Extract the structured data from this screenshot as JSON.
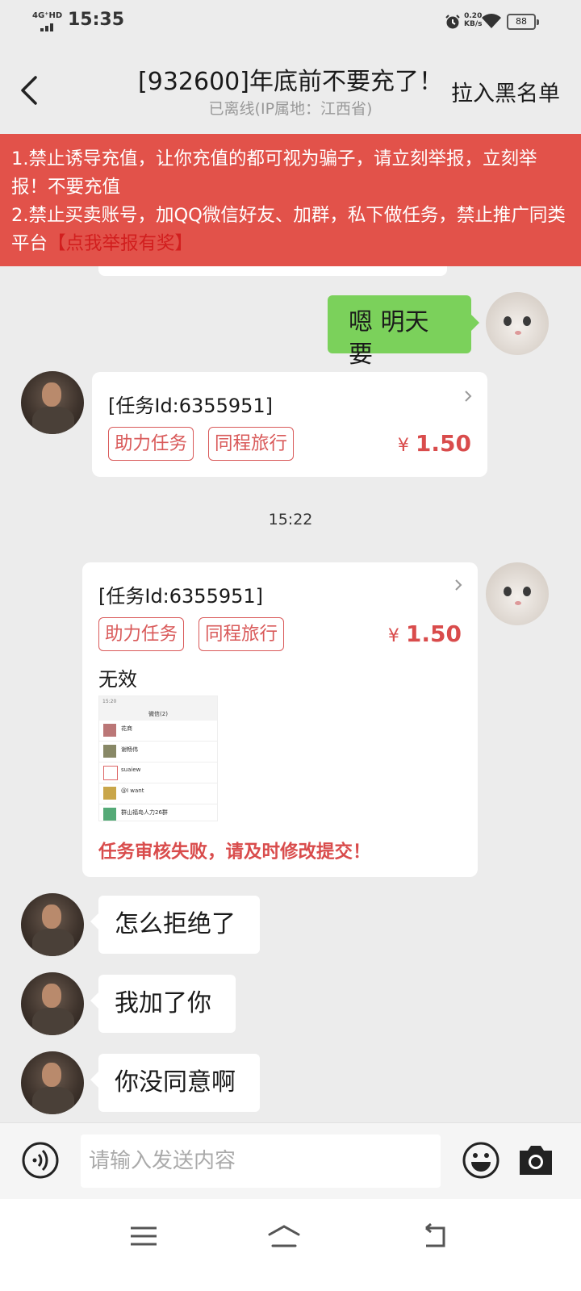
{
  "status_bar": {
    "network": "4G⁺HD",
    "time": "15:35",
    "speed_value": "0.20",
    "speed_unit": "KB/s",
    "battery": "88"
  },
  "header": {
    "title": "[932600]年底前不要充了！",
    "subtitle": "已离线(IP属地：江西省)",
    "blacklist": "拉入黑名单"
  },
  "banner": {
    "line1": "1.禁止诱导充值，让你充值的都可视为骗子，请立刻举报，立刻举报！不要充值",
    "line2": "2.禁止买卖账号，加QQ微信好友、加群，私下做任务，禁止推广同类平台",
    "report_link": "【点我举报有奖】"
  },
  "messages": {
    "m1": "嗯 明天要",
    "task1": {
      "id_text": "[任务Id:6355951]",
      "tags": [
        "助力任务",
        "同程旅行"
      ],
      "currency": "¥",
      "price": "1.50"
    },
    "timestamp": "15:22",
    "task2": {
      "id_text": "[任务Id:6355951]",
      "tags": [
        "助力任务",
        "同程旅行"
      ],
      "currency": "¥",
      "price": "1.50",
      "result": "无效",
      "fail_note": "任务审核失败，请及时修改提交！",
      "thumb": {
        "status_time": "15:20",
        "header": "微信(2)",
        "rows": [
          "花商",
          "谢畅伟",
          "suaiew",
          "@I want",
          "群山福岛人力26群"
        ]
      }
    },
    "m2": "怎么拒绝了",
    "m3": "我加了你",
    "m4": "你没同意啊"
  },
  "input": {
    "placeholder": "请输入发送内容"
  },
  "icons": {
    "back": "chevron-left-icon",
    "voice": "voice-icon",
    "emoji": "smiley-icon",
    "camera": "camera-icon"
  },
  "colors": {
    "banner": "#e2524a",
    "accent_red": "#d94c4c",
    "my_bubble": "#7bd15b",
    "background": "#ececec"
  }
}
